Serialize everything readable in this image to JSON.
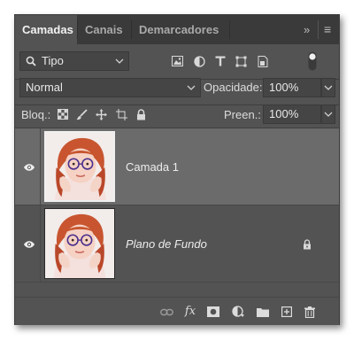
{
  "tabs": [
    {
      "label": "Camadas",
      "active": true
    },
    {
      "label": "Canais",
      "active": false
    },
    {
      "label": "Demarcadores",
      "active": false
    }
  ],
  "tabbar": {
    "expand_glyph": "»",
    "menu_glyph": "≡"
  },
  "filter": {
    "kind_label": "Tipo",
    "icons": [
      "image-filter-icon",
      "adjustment-filter-icon",
      "type-filter-icon",
      "shape-filter-icon",
      "smart-object-filter-icon",
      "filter-toggle-icon"
    ]
  },
  "blend": {
    "mode": "Normal",
    "opacity_label": "Opacidade:",
    "opacity_value": "100%"
  },
  "lock": {
    "label": "Bloq.:",
    "fill_label": "Preen.:",
    "fill_value": "100%",
    "icons": [
      "lock-transparent-icon",
      "lock-image-icon",
      "lock-position-icon",
      "lock-artboard-icon",
      "lock-all-icon"
    ]
  },
  "layers": [
    {
      "name": "Camada 1",
      "selected": true,
      "italic": false,
      "locked": false
    },
    {
      "name": "Plano de Fundo",
      "selected": false,
      "italic": true,
      "locked": true
    }
  ],
  "footer": {
    "fx_label": "fx",
    "icons": [
      "link-layers-icon",
      "fx-icon",
      "add-mask-icon",
      "adjustment-layer-icon",
      "new-group-icon",
      "new-layer-icon",
      "delete-icon"
    ]
  },
  "colors": {
    "panel": "#535353",
    "tabbar": "#3a3a3a",
    "selected_layer": "#6b6b6b"
  }
}
